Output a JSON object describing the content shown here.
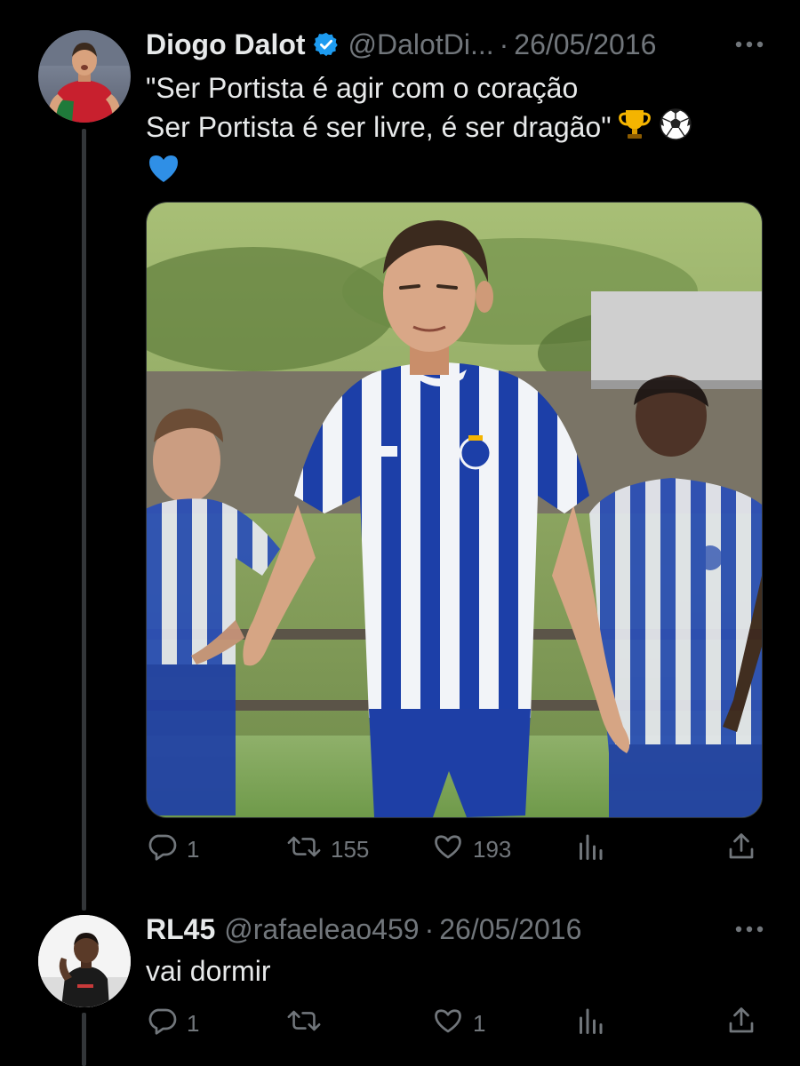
{
  "colors": {
    "background": "#000000",
    "text": "#e7e9ea",
    "secondary": "#71767b",
    "verified": "#1d9bf0",
    "thread_line": "#333639"
  },
  "tweets": [
    {
      "author_name": "Diogo Dalot",
      "verified": true,
      "handle": "@DalotDi...",
      "separator": "·",
      "date": "26/05/2016",
      "text_lines": [
        "\"Ser Portista é agir com o coração",
        "Ser Portista é ser livre, é ser dragão\""
      ],
      "emojis": [
        "trophy",
        "soccer-ball",
        "blue-heart"
      ],
      "has_media": true,
      "actions": {
        "replies": "1",
        "retweets": "155",
        "likes": "193",
        "views": "",
        "share": ""
      }
    },
    {
      "author_name": "RL45",
      "verified": false,
      "handle": "@rafaeleao459",
      "separator": "·",
      "date": "26/05/2016",
      "text_lines": [
        "vai dormir"
      ],
      "has_media": false,
      "actions": {
        "replies": "1",
        "retweets": "",
        "likes": "1",
        "views": "",
        "share": ""
      }
    }
  ],
  "icons": {
    "more": "more-horizontal-icon",
    "reply": "reply-icon",
    "retweet": "retweet-icon",
    "like": "heart-icon",
    "views": "views-chart-icon",
    "share": "share-icon"
  }
}
